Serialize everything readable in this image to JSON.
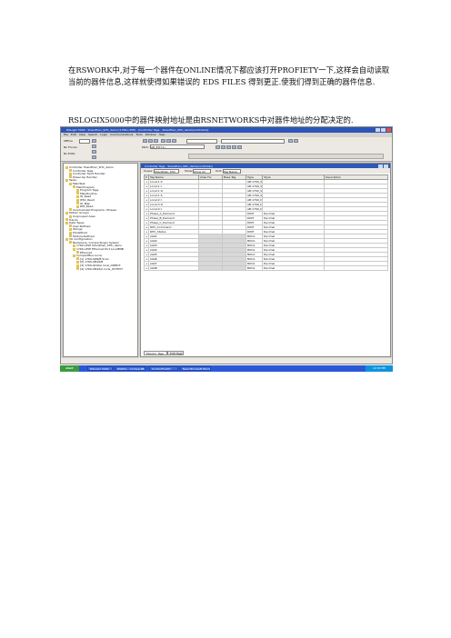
{
  "document": {
    "paragraph1": "在RSWORK中,对于每一个器件在ONLINE情况下都应该打开PROFIETY一下,这样会自动读取当前的器件信息,这样就使得如果错误的 EDS FILES 得到更正.使我们得到正确的器件信息.",
    "paragraph2": "RSLOGIX5000中的器件映射地址是由RSNETWORKS中对器件地址的分配决定的."
  },
  "screenshot": {
    "titlebar": "RSLogix 5000 - ShenZhen_SHC_demo [1769-L35E] - [Controller Tags - ShenZhen_SHC_demo(controller)]",
    "menus": [
      "File",
      "Edit",
      "View",
      "Search",
      "Logic",
      "Communications",
      "Tools",
      "Window",
      "Help"
    ],
    "toolbar_labels": [
      "Offline",
      "No Forces",
      "No Edits",
      "Path:",
      "AB_ETH-1\\"
    ],
    "pane_title": "Controller Tags - ShenZhen_SHC_demo(controller)",
    "filter": {
      "scope_label": "Scope:",
      "scope_value": "ShenZhen_SHC",
      "show_label": "Show:",
      "show_value": "Show All",
      "sort_label": "Sort:",
      "sort_value": "Tag Name"
    },
    "columns": [
      "P",
      "Tag Name",
      "Alias For",
      "Base Tag",
      "Type",
      "Style",
      "Description"
    ],
    "tree": [
      {
        "label": "Controller ShenZhen_SHC_demo",
        "indent": 0
      },
      {
        "label": "Controller Tags",
        "indent": 1
      },
      {
        "label": "Controller Fault Handler",
        "indent": 1
      },
      {
        "label": "Power-Up Handler",
        "indent": 1
      },
      {
        "label": "Tasks",
        "indent": 0
      },
      {
        "label": "MainTask",
        "indent": 1
      },
      {
        "label": "MainProgram",
        "indent": 2
      },
      {
        "label": "Program Tags",
        "indent": 3
      },
      {
        "label": "MainRoutine",
        "indent": 3
      },
      {
        "label": "IO_Read",
        "indent": 3
      },
      {
        "label": "IPSC_Read",
        "indent": 3
      },
      {
        "label": "IO_Map",
        "indent": 3
      },
      {
        "label": "RIO_Read",
        "indent": 3
      },
      {
        "label": "Unscheduled Programs / Phases",
        "indent": 1
      },
      {
        "label": "Motion Groups",
        "indent": 0
      },
      {
        "label": "Ungrouped Axes",
        "indent": 1
      },
      {
        "label": "Trends",
        "indent": 0
      },
      {
        "label": "Data Types",
        "indent": 0
      },
      {
        "label": "User-Defined",
        "indent": 1
      },
      {
        "label": "Strings",
        "indent": 1
      },
      {
        "label": "Predefined",
        "indent": 1
      },
      {
        "label": "Module-Defined",
        "indent": 1
      },
      {
        "label": "I/O Configuration",
        "indent": 0
      },
      {
        "label": "Backplane, CompactLogix System",
        "indent": 1
      },
      {
        "label": "1769-L35E ShenZhen_SHC_demo",
        "indent": 2
      },
      {
        "label": "1769-L35E Ethernet Port LocalENB",
        "indent": 2
      },
      {
        "label": "Ethernet",
        "indent": 3
      },
      {
        "label": "CompactBus Local",
        "indent": 2
      },
      {
        "label": "[1] 1769-SDN/B Scan",
        "indent": 3
      },
      {
        "label": "[2] 1769-OB16/B",
        "indent": 3
      },
      {
        "label": "[3] 1769-IQ16/A local_DIRECT",
        "indent": 3
      },
      {
        "label": "[4] 1769-OB16/A local_OUTPUT",
        "indent": 3
      }
    ],
    "rows": [
      {
        "name": "Local:1:C",
        "alias": "",
        "base": "",
        "type": "AB:1769_SDN:C:0",
        "style": "",
        "desc": "",
        "gray": false
      },
      {
        "name": "Local:1:I",
        "alias": "",
        "base": "",
        "type": "AB:1769_SDN_496Byte:I:0",
        "style": "",
        "desc": "",
        "gray": false
      },
      {
        "name": "Local:1:O",
        "alias": "",
        "base": "",
        "type": "AB:1769_SDN_496Byte:O:0",
        "style": "",
        "desc": "",
        "gray": false
      },
      {
        "name": "Local:1:S",
        "alias": "",
        "base": "",
        "type": "AB:1769_SDN:S:0",
        "style": "",
        "desc": "",
        "gray": false
      },
      {
        "name": "Local:2:I",
        "alias": "",
        "base": "",
        "type": "AB:1769_DI16:I:0",
        "style": "",
        "desc": "",
        "gray": false
      },
      {
        "name": "Local:3:O",
        "alias": "",
        "base": "",
        "type": "AB:1769_DO16:O:0",
        "style": "",
        "desc": "",
        "gray": false
      },
      {
        "name": "Local:4:I",
        "alias": "",
        "base": "",
        "type": "AB:1769_DI16:I:0",
        "style": "",
        "desc": "",
        "gray": false
      },
      {
        "name": "Phase_A_Demand",
        "alias": "",
        "base": "",
        "type": "DINT",
        "style": "Decimal",
        "desc": "",
        "gray": false
      },
      {
        "name": "Phase_B_Demand",
        "alias": "",
        "base": "",
        "type": "DINT",
        "style": "Decimal",
        "desc": "",
        "gray": false
      },
      {
        "name": "Phase_C_Demand",
        "alias": "",
        "base": "",
        "type": "DINT",
        "style": "Decimal",
        "desc": "",
        "gray": false
      },
      {
        "name": "RHC_Command",
        "alias": "",
        "base": "",
        "type": "DINT",
        "style": "Decimal",
        "desc": "",
        "gray": false
      },
      {
        "name": "RHC_Status",
        "alias": "",
        "base": "",
        "type": "DINT",
        "style": "Decimal",
        "desc": "",
        "gray": false
      },
      {
        "name": "stat1",
        "alias": "",
        "base": "",
        "type": "BOOL",
        "style": "Decimal",
        "desc": "",
        "gray": true
      },
      {
        "name": "stat2",
        "alias": "",
        "base": "",
        "type": "BOOL",
        "style": "Decimal",
        "desc": "",
        "gray": true
      },
      {
        "name": "stat3",
        "alias": "",
        "base": "",
        "type": "BOOL",
        "style": "Decimal",
        "desc": "",
        "gray": true
      },
      {
        "name": "stat4",
        "alias": "",
        "base": "",
        "type": "BOOL",
        "style": "Decimal",
        "desc": "",
        "gray": true
      },
      {
        "name": "stat5",
        "alias": "",
        "base": "",
        "type": "BOOL",
        "style": "Decimal",
        "desc": "",
        "gray": true
      },
      {
        "name": "stat6",
        "alias": "",
        "base": "",
        "type": "BOOL",
        "style": "Decimal",
        "desc": "",
        "gray": true
      },
      {
        "name": "stat7",
        "alias": "",
        "base": "",
        "type": "BOOL",
        "style": "Decimal",
        "desc": "",
        "gray": true
      },
      {
        "name": "stat8",
        "alias": "",
        "base": "",
        "type": "BOOL",
        "style": "Decimal",
        "desc": "",
        "gray": true
      }
    ],
    "tabs": [
      "Monitor Tags",
      "Edit Tags"
    ],
    "taskbar": {
      "start": "start",
      "items": [
        "RSLogix 5000 - Shen...",
        "RSWho - CompactBus...",
        "ControlFLASH",
        "New Microsoft Word..."
      ],
      "clock": "12:00 PM"
    }
  }
}
